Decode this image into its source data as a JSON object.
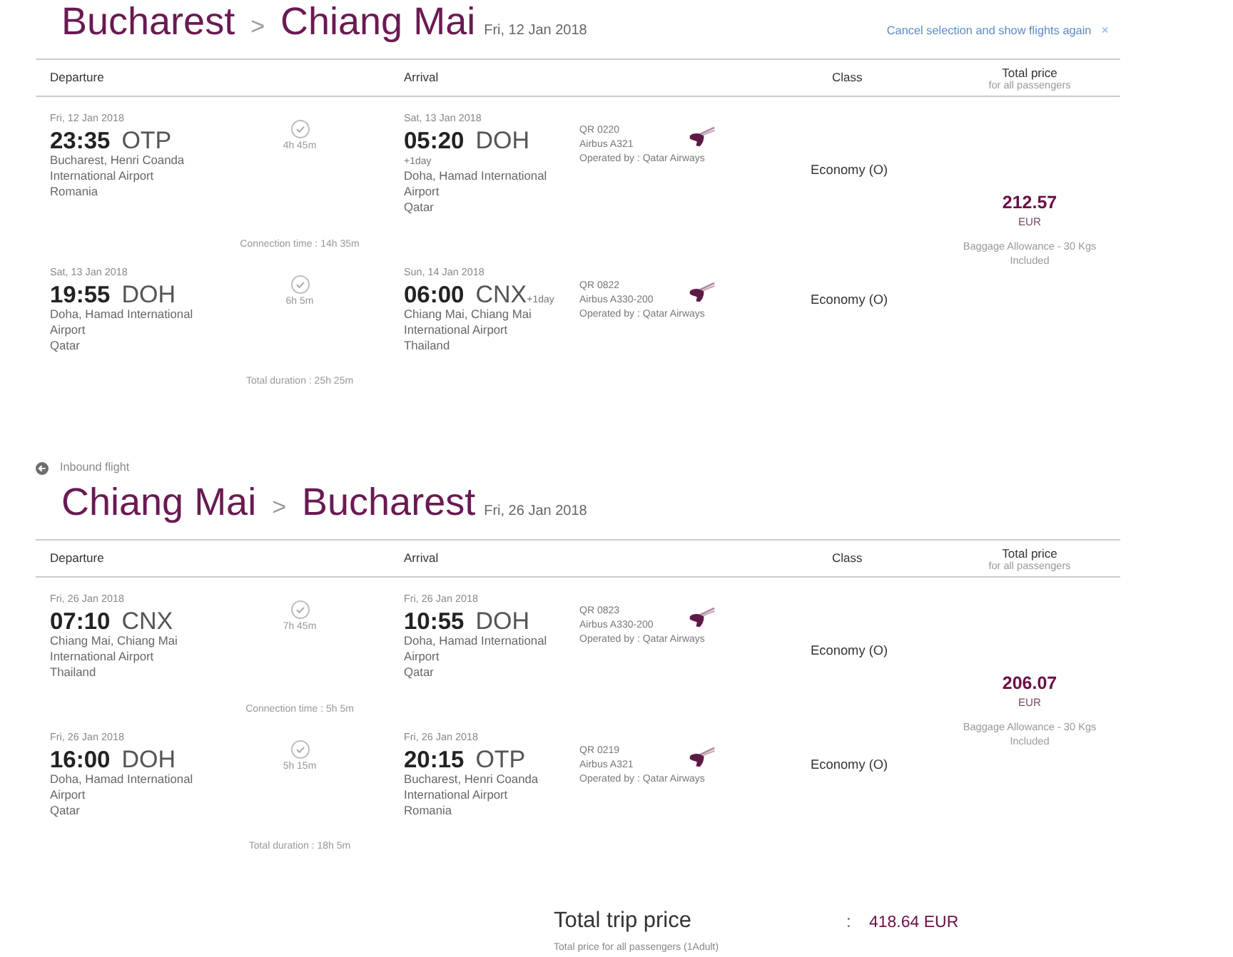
{
  "bounds": [
    {
      "route": {
        "origin": "Bucharest",
        "separator": ">",
        "destination": "Chiang Mai",
        "date": "Fri, 12 Jan 2018"
      },
      "cancel_link": {
        "label": "Cancel selection and show flights again",
        "close_glyph": "×"
      },
      "columns": {
        "departure": "Departure",
        "arrival": "Arrival",
        "class": "Class",
        "price": "Total price",
        "price_note": "for all passengers"
      },
      "segments": [
        {
          "departure": {
            "date": "Fri, 12 Jan 2018",
            "time": "23:35",
            "code": "OTP",
            "airport": "Bucharest, Henri Coanda International Airport",
            "country": "Romania"
          },
          "duration": "4h 45m",
          "arrival": {
            "date": "Sat, 13 Jan 2018",
            "time": "05:20",
            "code": "DOH",
            "next_day": {
              "label": "+1day",
              "kind": "below"
            },
            "airport": "Doha, Hamad International Airport",
            "country": "Qatar"
          },
          "flight": {
            "number": "QR 0220",
            "aircraft": "Airbus A321",
            "operator": "Operated by : Qatar Airways"
          },
          "class": "Economy (O)"
        },
        {
          "departure": {
            "date": "Sat, 13 Jan 2018",
            "time": "19:55",
            "code": "DOH",
            "airport": "Doha, Hamad International Airport",
            "country": "Qatar"
          },
          "duration": "6h 5m",
          "arrival": {
            "date": "Sun, 14 Jan 2018",
            "time": "06:00",
            "code": "CNX",
            "next_day": {
              "label": "+1day",
              "kind": "inline"
            },
            "airport": "Chiang Mai, Chiang Mai International Airport",
            "country": "Thailand"
          },
          "flight": {
            "number": "QR 0822",
            "aircraft": "Airbus A330-200",
            "operator": "Operated by : Qatar Airways"
          },
          "class": "Economy (O)"
        }
      ],
      "connections": [
        "Connection time : 14h 35m"
      ],
      "total_duration": "Total duration : 25h 25m",
      "price": {
        "amount": "212.57",
        "currency": "EUR",
        "baggage": "Baggage Allowance - 30 Kgs Included"
      }
    },
    {
      "label": "Inbound flight",
      "route": {
        "origin": "Chiang Mai",
        "separator": ">",
        "destination": "Bucharest",
        "date": "Fri, 26 Jan 2018"
      },
      "columns": {
        "departure": "Departure",
        "arrival": "Arrival",
        "class": "Class",
        "price": "Total price",
        "price_note": "for all passengers"
      },
      "segments": [
        {
          "departure": {
            "date": "Fri, 26 Jan 2018",
            "time": "07:10",
            "code": "CNX",
            "airport": "Chiang Mai, Chiang Mai International Airport",
            "country": "Thailand"
          },
          "duration": "7h 45m",
          "arrival": {
            "date": "Fri, 26 Jan 2018",
            "time": "10:55",
            "code": "DOH",
            "airport": "Doha, Hamad International Airport",
            "country": "Qatar"
          },
          "flight": {
            "number": "QR 0823",
            "aircraft": "Airbus A330-200",
            "operator": "Operated by : Qatar Airways"
          },
          "class": "Economy (O)"
        },
        {
          "departure": {
            "date": "Fri, 26 Jan 2018",
            "time": "16:00",
            "code": "DOH",
            "airport": "Doha, Hamad International Airport",
            "country": "Qatar"
          },
          "duration": "5h 15m",
          "arrival": {
            "date": "Fri, 26 Jan 2018",
            "time": "20:15",
            "code": "OTP",
            "airport": "Bucharest, Henri Coanda International Airport",
            "country": "Romania"
          },
          "flight": {
            "number": "QR 0219",
            "aircraft": "Airbus A321",
            "operator": "Operated by : Qatar Airways"
          },
          "class": "Economy (O)"
        }
      ],
      "connections": [
        "Connection time : 5h 5m"
      ],
      "total_duration": "Total duration : 18h 5m",
      "price": {
        "amount": "206.07",
        "currency": "EUR",
        "baggage": "Baggage Allowance - 30 Kgs Included"
      }
    }
  ],
  "trip_total": {
    "label": "Total trip price",
    "separator": ":",
    "amount": "418.64 EUR",
    "note": "Total price for all passengers (1Adult)"
  }
}
